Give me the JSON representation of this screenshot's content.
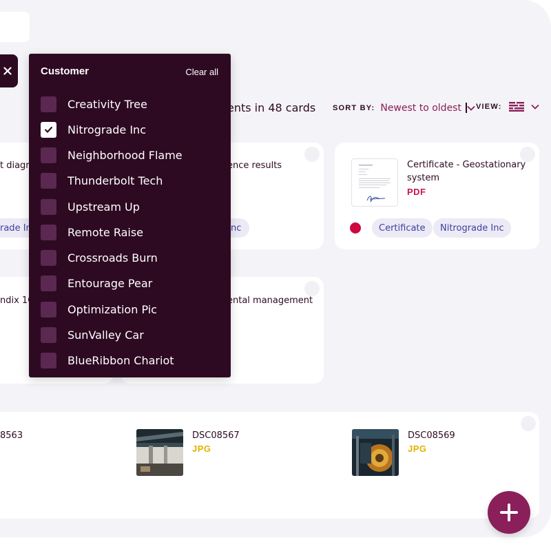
{
  "summary": {
    "text": "ents in 48 cards"
  },
  "sort": {
    "label": "SORT BY:",
    "value": "Newest to oldest"
  },
  "view": {
    "label": "VIEW:"
  },
  "colors": {
    "accent": "#8a1f5a",
    "dark": "#2d0a22",
    "pdf": "#c8134f",
    "jpg": "#e3b200",
    "status": "#d0063f"
  },
  "dropdown": {
    "title": "Customer",
    "clear_label": "Clear all",
    "items": [
      {
        "label": "Creativity Tree",
        "checked": false
      },
      {
        "label": "Nitrograde Inc",
        "checked": true
      },
      {
        "label": "Neighborhood Flame",
        "checked": false
      },
      {
        "label": "Thunderbolt Tech",
        "checked": false
      },
      {
        "label": "Upstream Up",
        "checked": false
      },
      {
        "label": "Remote Raise",
        "checked": false
      },
      {
        "label": "Crossroads Burn",
        "checked": false
      },
      {
        "label": "Entourage Pear",
        "checked": false
      },
      {
        "label": "Optimization Pic",
        "checked": false
      },
      {
        "label": "SunValley Car",
        "checked": false
      },
      {
        "label": "BlueRibbon Chariot",
        "checked": false
      }
    ]
  },
  "cards": {
    "c1": {
      "title": "t diagra",
      "tag": "rade Inc"
    },
    "c2": {
      "title": "ence results",
      "tag": "nc"
    },
    "c3": {
      "title_line1": "Certificate - Geostationary",
      "title_line2": "system",
      "type": "PDF",
      "tags": [
        "Certificate",
        "Nitrograde Inc"
      ]
    },
    "c4": {
      "title": "ndix 1C"
    },
    "c5": {
      "title": "ental management"
    },
    "c6": {
      "title": "8563"
    },
    "c7": {
      "title": "DSC08567",
      "type": "JPG"
    },
    "c8": {
      "title": "DSC08569",
      "type": "JPG"
    }
  },
  "icons": {
    "close": "close-icon",
    "chevron": "chevron-down-icon",
    "view": "list-view-icon",
    "check": "check-icon",
    "add": "plus-icon"
  }
}
